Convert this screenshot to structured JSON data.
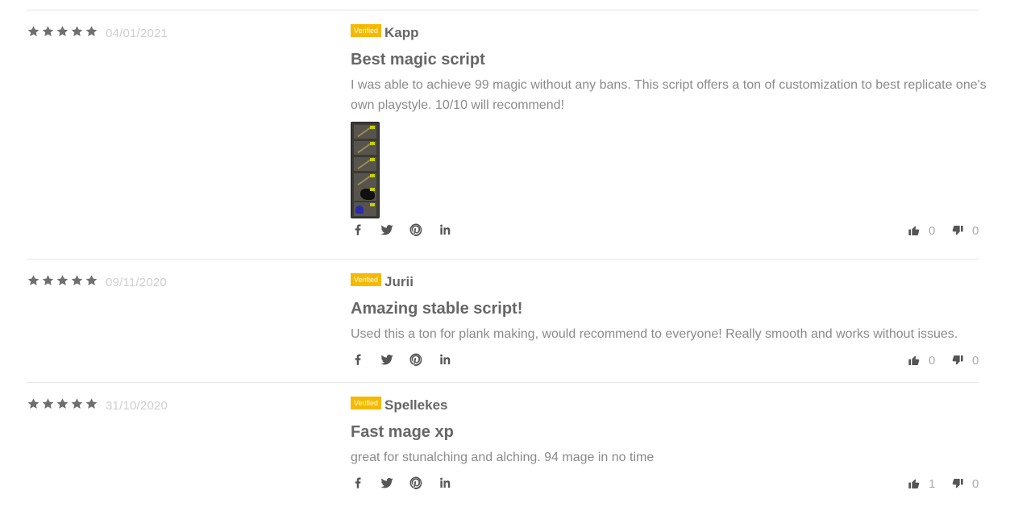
{
  "reviews": [
    {
      "rating": 5,
      "date": "04/01/2021",
      "badge": "Verified",
      "author": "Kapp",
      "title": "Best magic script",
      "text": "I was able to achieve 99 magic without any bans. This script offers a ton of customization to best replicate one's own playstyle. 10/10 will recommend!",
      "has_attachment": true,
      "upvotes": "0",
      "downvotes": "0"
    },
    {
      "rating": 5,
      "date": "09/11/2020",
      "badge": "Verified",
      "author": "Jurii",
      "title": "Amazing stable script!",
      "text": "Used this a ton for plank making, would recommend to everyone! Really smooth and works without issues.",
      "has_attachment": false,
      "upvotes": "0",
      "downvotes": "0"
    },
    {
      "rating": 5,
      "date": "31/10/2020",
      "badge": "Verified",
      "author": "Spellekes",
      "title": "Fast mage xp",
      "text": "great for stunalching and alching. 94 mage in no time",
      "has_attachment": false,
      "upvotes": "1",
      "downvotes": "0"
    }
  ],
  "share_icons": [
    "facebook-icon",
    "twitter-icon",
    "pinterest-icon",
    "linkedin-icon"
  ],
  "colors": {
    "badge": "#f6b800",
    "star": "#6f6f6f",
    "date": "#cfcfcf",
    "text": "#8a8a8a",
    "heading": "#666666",
    "divider": "#e6e6e6"
  }
}
